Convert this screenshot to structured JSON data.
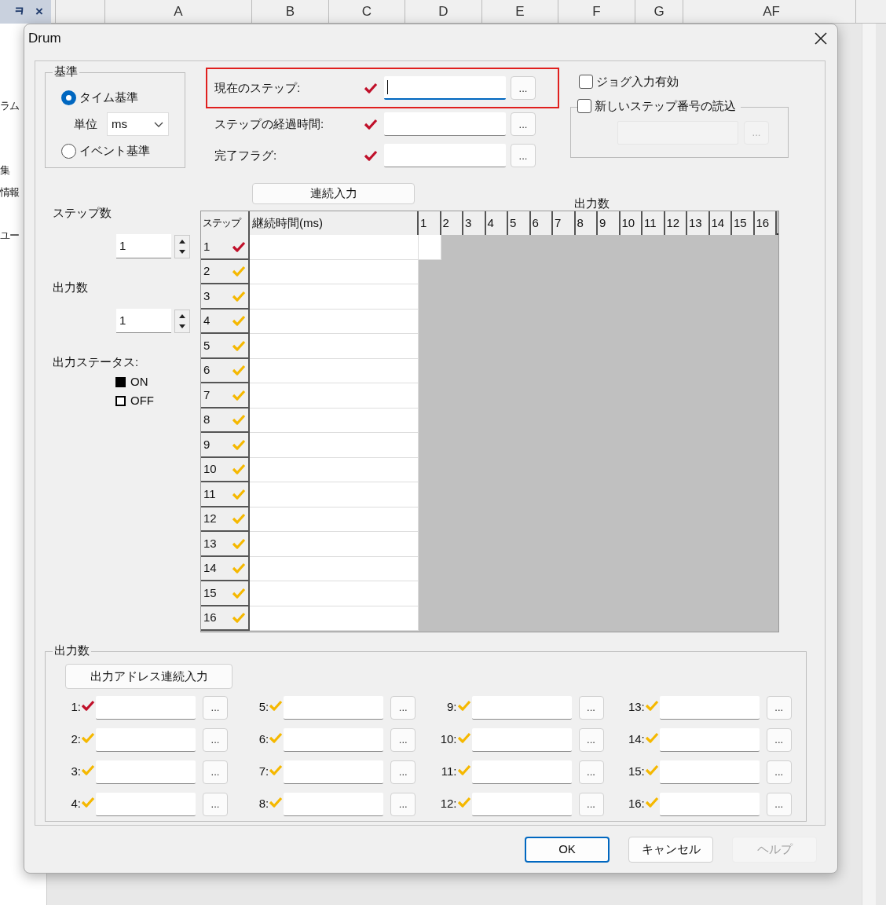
{
  "sheet": {
    "pane_icons": [
      "ᆿ",
      "×"
    ],
    "column_headers": [
      "A",
      "B",
      "C",
      "D",
      "E",
      "F",
      "G",
      "AF"
    ],
    "side_texts": [
      "ラム",
      "集",
      "情報",
      "ユー"
    ]
  },
  "dialog": {
    "title": "Drum"
  },
  "basis": {
    "legend": "基準",
    "unit_label": "単位",
    "unit_value": "ms",
    "options": [
      {
        "label": "タイム基準",
        "selected": true
      },
      {
        "label": "イベント基準",
        "selected": false
      }
    ]
  },
  "fields": [
    {
      "label": "現在のステップ:",
      "color": "#c0102a",
      "highlighted": true,
      "focused": true,
      "button": "..."
    },
    {
      "label": "ステップの経過時間:",
      "color": "#c0102a",
      "highlighted": false,
      "focused": false,
      "button": "..."
    },
    {
      "label": "完了フラグ:",
      "color": "#c0102a",
      "highlighted": false,
      "focused": false,
      "button": "..."
    }
  ],
  "jog": {
    "label": "ジョグ入力有効",
    "checked": false
  },
  "new_step": {
    "label": "新しいステップ番号の読込",
    "checked": false,
    "button": "...",
    "disabled": true
  },
  "continuous_button": "連続入力",
  "step_count": {
    "label": "ステップ数",
    "value": "1"
  },
  "output_count": {
    "label": "出力数",
    "value": "1"
  },
  "status_legend": {
    "label": "出力ステータス:",
    "items": [
      {
        "label": "ON",
        "kind": "filled"
      },
      {
        "label": "OFF",
        "kind": "empty"
      }
    ]
  },
  "table": {
    "title": "出力数",
    "columns": [
      "ステップ",
      "継続時間(ms)"
    ],
    "outputs": [
      {
        "label": "1",
        "active": true
      },
      {
        "label": "2",
        "active": false
      },
      {
        "label": "3",
        "active": false
      },
      {
        "label": "4",
        "active": false
      },
      {
        "label": "5",
        "active": false
      },
      {
        "label": "6",
        "active": false
      },
      {
        "label": "7",
        "active": false
      },
      {
        "label": "8",
        "active": false
      },
      {
        "label": "9",
        "active": false
      },
      {
        "label": "10",
        "active": false
      },
      {
        "label": "11",
        "active": false
      },
      {
        "label": "12",
        "active": false
      },
      {
        "label": "13",
        "active": false
      },
      {
        "label": "14",
        "active": false
      },
      {
        "label": "15",
        "active": false
      },
      {
        "label": "16",
        "active": false
      }
    ],
    "rows": [
      {
        "step": "1",
        "color": "#c0102a",
        "active": true
      },
      {
        "step": "2",
        "color": "#f5b800",
        "active": false
      },
      {
        "step": "3",
        "color": "#f5b800",
        "active": false
      },
      {
        "step": "4",
        "color": "#f5b800",
        "active": false
      },
      {
        "step": "5",
        "color": "#f5b800",
        "active": false
      },
      {
        "step": "6",
        "color": "#f5b800",
        "active": false
      },
      {
        "step": "7",
        "color": "#f5b800",
        "active": false
      },
      {
        "step": "8",
        "color": "#f5b800",
        "active": false
      },
      {
        "step": "9",
        "color": "#f5b800",
        "active": false
      },
      {
        "step": "10",
        "color": "#f5b800",
        "active": false
      },
      {
        "step": "11",
        "color": "#f5b800",
        "active": false
      },
      {
        "step": "12",
        "color": "#f5b800",
        "active": false
      },
      {
        "step": "13",
        "color": "#f5b800",
        "active": false
      },
      {
        "step": "14",
        "color": "#f5b800",
        "active": false
      },
      {
        "step": "15",
        "color": "#f5b800",
        "active": false
      },
      {
        "step": "16",
        "color": "#f5b800",
        "active": false
      }
    ]
  },
  "outputs_group": {
    "legend": "出力数",
    "button": "出力アドレス連続入力",
    "items": [
      {
        "label": "1:",
        "color": "#c0102a",
        "button": "..."
      },
      {
        "label": "2:",
        "color": "#f5b800",
        "button": "..."
      },
      {
        "label": "3:",
        "color": "#f5b800",
        "button": "..."
      },
      {
        "label": "4:",
        "color": "#f5b800",
        "button": "..."
      },
      {
        "label": "5:",
        "color": "#f5b800",
        "button": "..."
      },
      {
        "label": "6:",
        "color": "#f5b800",
        "button": "..."
      },
      {
        "label": "7:",
        "color": "#f5b800",
        "button": "..."
      },
      {
        "label": "8:",
        "color": "#f5b800",
        "button": "..."
      },
      {
        "label": "9:",
        "color": "#f5b800",
        "button": "..."
      },
      {
        "label": "10:",
        "color": "#f5b800",
        "button": "..."
      },
      {
        "label": "11:",
        "color": "#f5b800",
        "button": "..."
      },
      {
        "label": "12:",
        "color": "#f5b800",
        "button": "..."
      },
      {
        "label": "13:",
        "color": "#f5b800",
        "button": "..."
      },
      {
        "label": "14:",
        "color": "#f5b800",
        "button": "..."
      },
      {
        "label": "15:",
        "color": "#f5b800",
        "button": "..."
      },
      {
        "label": "16:",
        "color": "#f5b800",
        "button": "..."
      }
    ]
  },
  "buttons": [
    {
      "label": "OK",
      "default": true,
      "disabled": false
    },
    {
      "label": "キャンセル",
      "default": false,
      "disabled": false
    },
    {
      "label": "ヘルプ",
      "default": false,
      "disabled": true
    }
  ]
}
